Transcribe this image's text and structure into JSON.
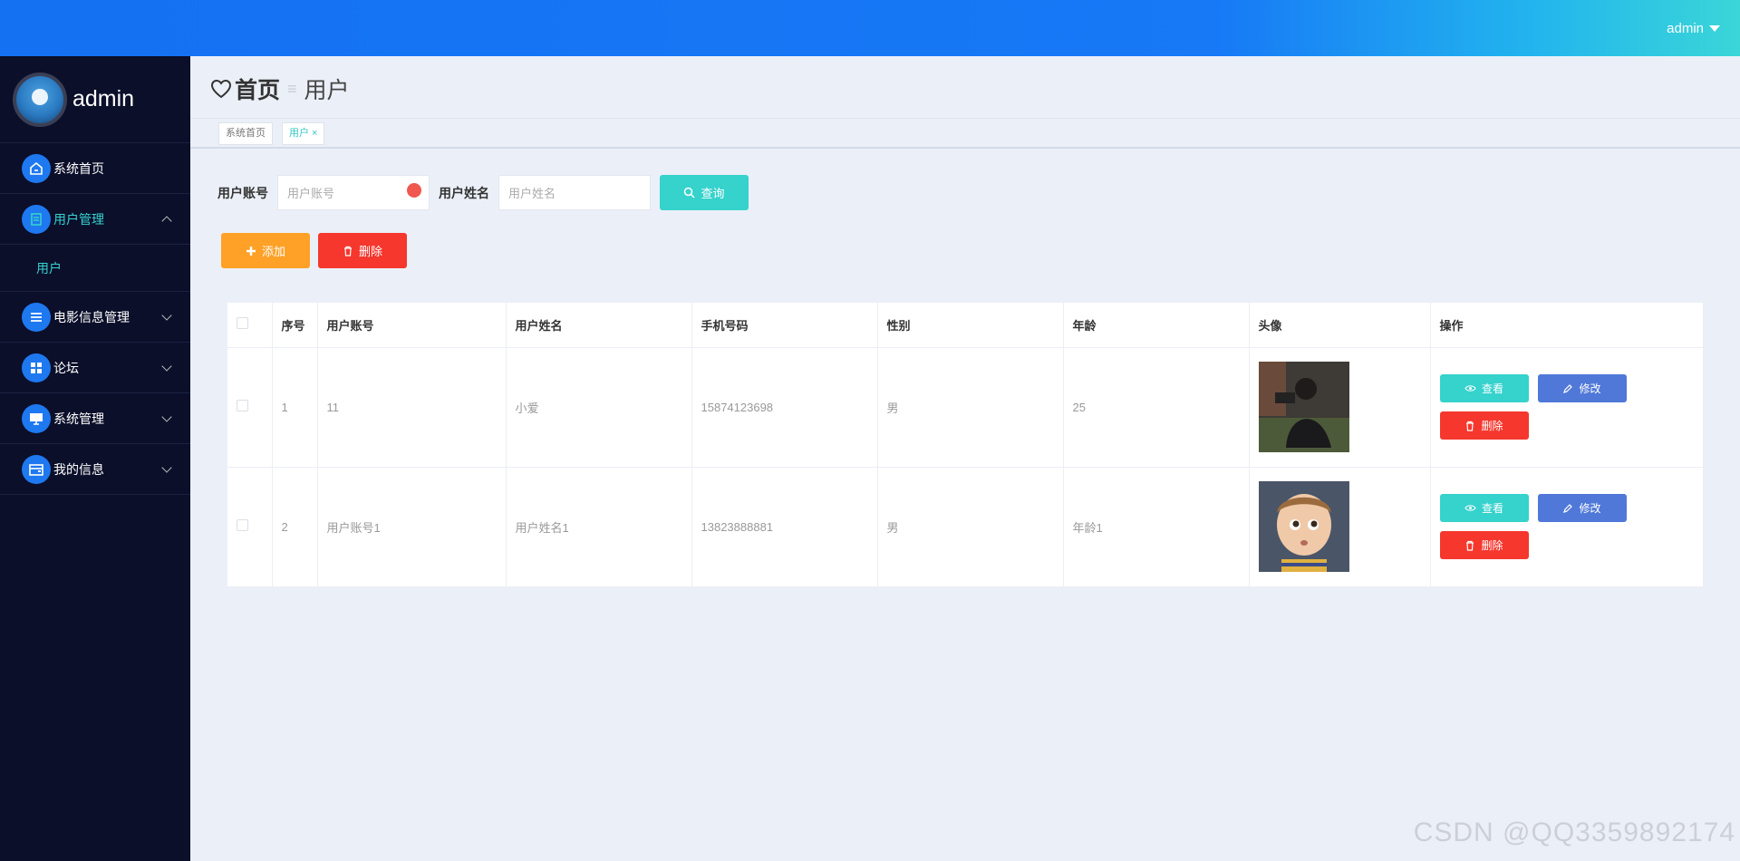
{
  "topbar": {
    "user_label": "admin"
  },
  "sidebar": {
    "brand_name": "admin",
    "items": [
      {
        "label": "系统首页",
        "icon": "home-icon"
      },
      {
        "label": "用户管理",
        "icon": "user-manage-icon",
        "expanded": true
      },
      {
        "label": "用户",
        "sub": true
      },
      {
        "label": "电影信息管理",
        "icon": "list-icon"
      },
      {
        "label": "论坛",
        "icon": "grid-icon"
      },
      {
        "label": "系统管理",
        "icon": "monitor-icon"
      },
      {
        "label": "我的信息",
        "icon": "wallet-icon"
      }
    ]
  },
  "breadcrumb": {
    "home": "首页",
    "sep": "≡",
    "current": "用户"
  },
  "tabs": [
    {
      "label": "系统首页"
    },
    {
      "label": "用户 ×"
    }
  ],
  "search": {
    "account_label": "用户账号",
    "account_placeholder": "用户账号",
    "name_label": "用户姓名",
    "name_placeholder": "用户姓名",
    "query_button": "查询"
  },
  "actions": {
    "add": "添加",
    "delete": "删除"
  },
  "table": {
    "headers": [
      "序号",
      "用户账号",
      "用户姓名",
      "手机号码",
      "性别",
      "年龄",
      "头像",
      "操作"
    ],
    "rows": [
      {
        "index": "1",
        "account": "11",
        "name": "小爱",
        "phone": "15874123698",
        "gender": "男",
        "age": "25"
      },
      {
        "index": "2",
        "account": "用户账号1",
        "name": "用户姓名1",
        "phone": "13823888881",
        "gender": "男",
        "age": "年龄1"
      }
    ],
    "row_buttons": {
      "view": "查看",
      "edit": "修改",
      "delete": "删除"
    }
  },
  "watermark": "CSDN @QQ3359892174",
  "colors": {
    "topbar": "#1471f2",
    "sidebar": "#0b0f2a",
    "accent": "#36d2cc",
    "orange": "#ffa127",
    "red": "#f5372d",
    "blue": "#4f78d8"
  }
}
